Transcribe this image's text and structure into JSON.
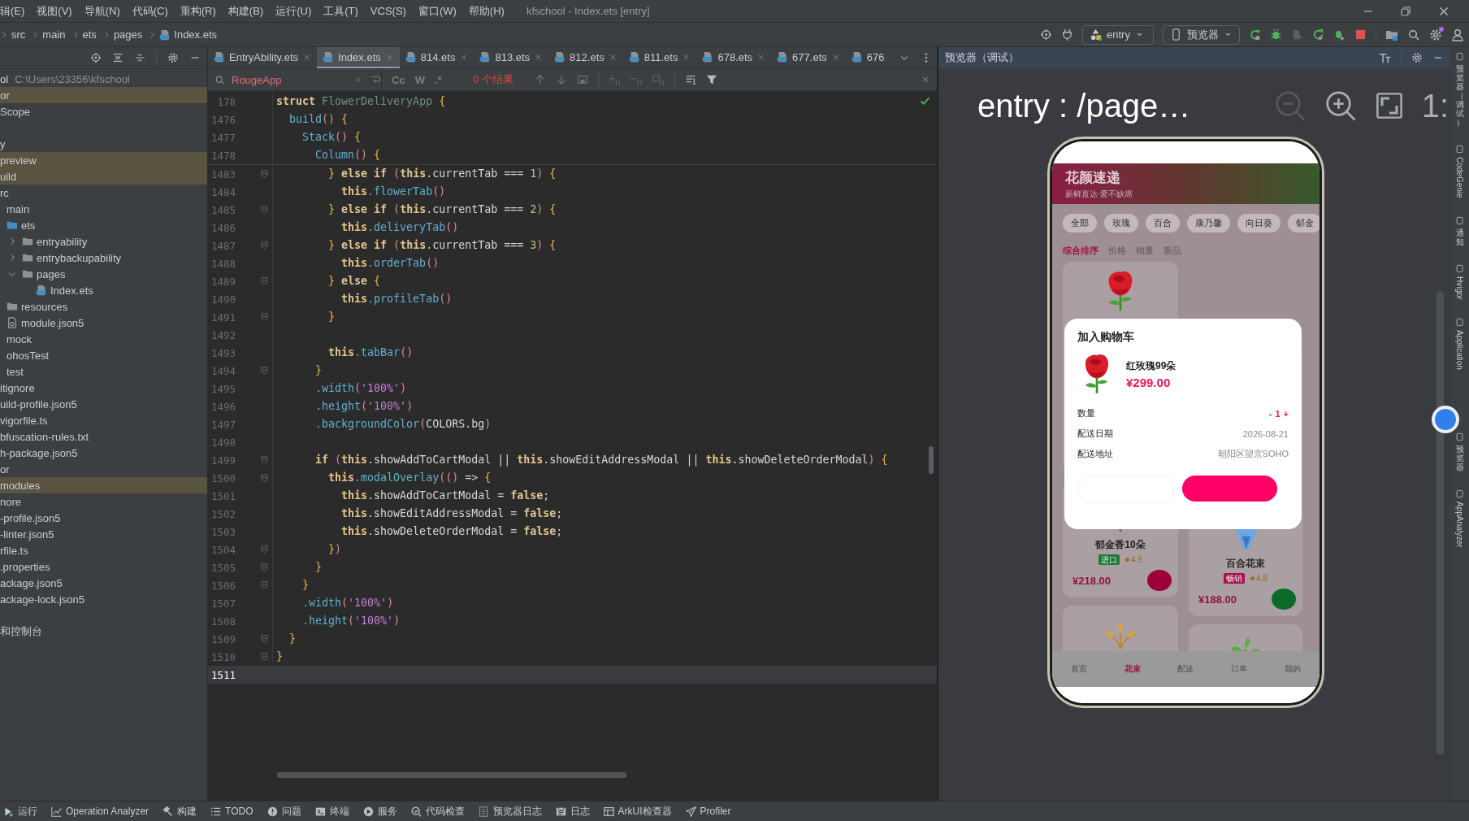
{
  "menu": [
    "辑(E)",
    "视图(V)",
    "导航(N)",
    "代码(C)",
    "重构(R)",
    "构建(B)",
    "运行(U)",
    "工具(T)",
    "VCS(S)",
    "窗口(W)",
    "帮助(H)"
  ],
  "window": {
    "title": "kfschool - Index.ets [entry]"
  },
  "breadcrumb": [
    {
      "label": "src",
      "kind": "folder"
    },
    {
      "label": "main",
      "kind": "folder"
    },
    {
      "label": "ets",
      "kind": "folder"
    },
    {
      "label": "pages",
      "kind": "folder"
    },
    {
      "label": "Index.ets",
      "kind": "file"
    }
  ],
  "toolbar": {
    "run_config": "entry",
    "device": "预览器"
  },
  "project": {
    "root": {
      "name": "ol",
      "path": "C:\\Users\\23356\\kfschool"
    },
    "items": [
      {
        "label": "or",
        "highlighted": true
      },
      {
        "label": "Scope",
        "highlighted": false
      },
      {
        "label": "y",
        "highlighted": false
      },
      {
        "label": "preview",
        "highlighted": true
      },
      {
        "label": "uild",
        "highlighted": true
      },
      {
        "label": "rc",
        "highlighted": false,
        "children": [
          {
            "label": "main",
            "highlighted": false,
            "children": [
              {
                "label": "ets",
                "highlighted": false,
                "kind": "source_folder",
                "children": [
                  {
                    "label": "entryability",
                    "highlighted": false,
                    "kind": "folder",
                    "expanded": false
                  },
                  {
                    "label": "entrybackupability",
                    "highlighted": false,
                    "kind": "folder",
                    "expanded": false
                  },
                  {
                    "label": "pages",
                    "highlighted": false,
                    "kind": "folder",
                    "expanded": true,
                    "children": [
                      {
                        "label": "Index.ets",
                        "highlighted": false,
                        "kind": "ets_file"
                      }
                    ]
                  }
                ]
              },
              {
                "label": "resources",
                "highlighted": false,
                "kind": "folder"
              },
              {
                "label": "module.json5",
                "highlighted": false,
                "kind": "config_file"
              }
            ]
          },
          {
            "label": "mock",
            "highlighted": false
          },
          {
            "label": "ohosTest",
            "highlighted": false
          },
          {
            "label": "test",
            "highlighted": false
          }
        ]
      },
      {
        "label": "itignore",
        "highlighted": false
      },
      {
        "label": "uild-profile.json5",
        "highlighted": false
      },
      {
        "label": "vigorfile.ts",
        "highlighted": false
      },
      {
        "label": "bfuscation-rules.txt",
        "highlighted": false
      },
      {
        "label": "h-package.json5",
        "highlighted": false
      },
      {
        "label": "or",
        "highlighted": false
      },
      {
        "label": "modules",
        "highlighted": true
      },
      {
        "label": "nore",
        "highlighted": false
      },
      {
        "label": "-profile.json5",
        "highlighted": false
      },
      {
        "label": "-linter.json5",
        "highlighted": false
      },
      {
        "label": "rfile.ts",
        "highlighted": false
      },
      {
        "label": ".properties",
        "highlighted": false
      },
      {
        "label": "ackage.json5",
        "highlighted": false
      },
      {
        "label": "ackage-lock.json5",
        "highlighted": false
      },
      {
        "label": "和控制台",
        "highlighted": false
      }
    ]
  },
  "editor": {
    "tabs": [
      {
        "label": "EntryAbility.ets",
        "selected": false,
        "closable": true
      },
      {
        "label": "Index.ets",
        "selected": true,
        "closable": true
      },
      {
        "label": "814.ets",
        "selected": false,
        "closable": true
      },
      {
        "label": "813.ets",
        "selected": false,
        "closable": true
      },
      {
        "label": "812.ets",
        "selected": false,
        "closable": true
      },
      {
        "label": "811.ets",
        "selected": false,
        "closable": true
      },
      {
        "label": "678.ets",
        "selected": false,
        "closable": true
      },
      {
        "label": "677.ets",
        "selected": false,
        "closable": true
      },
      {
        "label": "676",
        "selected": false,
        "closable": false
      }
    ],
    "search": {
      "query": "RougeApp",
      "options": [
        "Cc",
        "W",
        ".*"
      ],
      "result": "0 个结果"
    },
    "sticky_lines": [
      {
        "number": "178",
        "tokens": [
          {
            "kind": "keyword",
            "text": "struct "
          },
          {
            "kind": "type",
            "text": "FlowerDeliveryApp "
          },
          {
            "kind": "brace",
            "text": "{"
          }
        ]
      },
      {
        "number": "1476",
        "tokens": [
          {
            "kind": "function",
            "text": "  build"
          },
          {
            "kind": "paren",
            "text": "() "
          },
          {
            "kind": "brace",
            "text": "{"
          }
        ]
      },
      {
        "number": "1477",
        "tokens": [
          {
            "kind": "function",
            "text": "    Stack"
          },
          {
            "kind": "paren",
            "text": "() "
          },
          {
            "kind": "brace",
            "text": "{"
          }
        ]
      },
      {
        "number": "1478",
        "tokens": [
          {
            "kind": "function",
            "text": "      Column"
          },
          {
            "kind": "paren",
            "text": "() "
          },
          {
            "kind": "brace",
            "text": "{"
          }
        ]
      }
    ],
    "lines": [
      {
        "number": "1483",
        "fold": true,
        "current": false,
        "tokens": [
          {
            "kind": "brace",
            "text": "        } "
          },
          {
            "kind": "keyword",
            "text": "else if "
          },
          {
            "kind": "paren",
            "text": "("
          },
          {
            "kind": "keyword",
            "text": "this"
          },
          {
            "kind": "plain",
            "text": ".currentTab === "
          },
          {
            "kind": "number",
            "text": "1"
          },
          {
            "kind": "paren",
            "text": ") "
          },
          {
            "kind": "brace",
            "text": "{"
          }
        ]
      },
      {
        "number": "1484",
        "fold": false,
        "current": false,
        "tokens": [
          {
            "kind": "keyword",
            "text": "          this"
          },
          {
            "kind": "function",
            "text": ".flowerTab"
          },
          {
            "kind": "paren",
            "text": "()"
          }
        ]
      },
      {
        "number": "1485",
        "fold": true,
        "current": false,
        "tokens": [
          {
            "kind": "brace",
            "text": "        } "
          },
          {
            "kind": "keyword",
            "text": "else if "
          },
          {
            "kind": "paren",
            "text": "("
          },
          {
            "kind": "keyword",
            "text": "this"
          },
          {
            "kind": "plain",
            "text": ".currentTab === "
          },
          {
            "kind": "number",
            "text": "2"
          },
          {
            "kind": "paren",
            "text": ") "
          },
          {
            "kind": "brace",
            "text": "{"
          }
        ]
      },
      {
        "number": "1486",
        "fold": false,
        "current": false,
        "tokens": [
          {
            "kind": "keyword",
            "text": "          this"
          },
          {
            "kind": "function",
            "text": ".deliveryTab"
          },
          {
            "kind": "paren",
            "text": "()"
          }
        ]
      },
      {
        "number": "1487",
        "fold": true,
        "current": false,
        "tokens": [
          {
            "kind": "brace",
            "text": "        } "
          },
          {
            "kind": "keyword",
            "text": "else if "
          },
          {
            "kind": "paren",
            "text": "("
          },
          {
            "kind": "keyword",
            "text": "this"
          },
          {
            "kind": "plain",
            "text": ".currentTab === "
          },
          {
            "kind": "number",
            "text": "3"
          },
          {
            "kind": "paren",
            "text": ") "
          },
          {
            "kind": "brace",
            "text": "{"
          }
        ]
      },
      {
        "number": "1488",
        "fold": false,
        "current": false,
        "tokens": [
          {
            "kind": "keyword",
            "text": "          this"
          },
          {
            "kind": "function",
            "text": ".orderTab"
          },
          {
            "kind": "paren",
            "text": "()"
          }
        ]
      },
      {
        "number": "1489",
        "fold": true,
        "current": false,
        "tokens": [
          {
            "kind": "brace",
            "text": "        } "
          },
          {
            "kind": "keyword",
            "text": "else "
          },
          {
            "kind": "brace",
            "text": "{"
          }
        ]
      },
      {
        "number": "1490",
        "fold": false,
        "current": false,
        "tokens": [
          {
            "kind": "keyword",
            "text": "          this"
          },
          {
            "kind": "function",
            "text": ".profileTab"
          },
          {
            "kind": "paren",
            "text": "()"
          }
        ]
      },
      {
        "number": "1491",
        "fold": true,
        "current": false,
        "tokens": [
          {
            "kind": "brace",
            "text": "        }"
          }
        ]
      },
      {
        "number": "1492",
        "fold": false,
        "current": false
      },
      {
        "number": "1493",
        "fold": false,
        "current": false,
        "tokens": [
          {
            "kind": "keyword",
            "text": "        this"
          },
          {
            "kind": "function",
            "text": ".tabBar"
          },
          {
            "kind": "paren",
            "text": "()"
          }
        ]
      },
      {
        "number": "1494",
        "fold": true,
        "current": false,
        "tokens": [
          {
            "kind": "brace",
            "text": "      }"
          }
        ]
      },
      {
        "number": "1495",
        "fold": false,
        "current": false,
        "tokens": [
          {
            "kind": "function",
            "text": "      .width"
          },
          {
            "kind": "paren",
            "text": "("
          },
          {
            "kind": "string",
            "text": "'100%'"
          },
          {
            "kind": "paren",
            "text": ")"
          }
        ]
      },
      {
        "number": "1496",
        "fold": false,
        "current": false,
        "tokens": [
          {
            "kind": "function",
            "text": "      .height"
          },
          {
            "kind": "paren",
            "text": "("
          },
          {
            "kind": "string",
            "text": "'100%'"
          },
          {
            "kind": "paren",
            "text": ")"
          }
        ]
      },
      {
        "number": "1497",
        "fold": false,
        "current": false,
        "tokens": [
          {
            "kind": "function",
            "text": "      .backgroundColor"
          },
          {
            "kind": "paren",
            "text": "("
          },
          {
            "kind": "plain",
            "text": "COLORS.bg"
          },
          {
            "kind": "paren",
            "text": ")"
          }
        ]
      },
      {
        "number": "1498",
        "fold": false,
        "current": false
      },
      {
        "number": "1499",
        "fold": true,
        "current": false,
        "tokens": [
          {
            "kind": "keyword",
            "text": "      if "
          },
          {
            "kind": "paren",
            "text": "("
          },
          {
            "kind": "keyword",
            "text": "this"
          },
          {
            "kind": "plain",
            "text": ".showAddToCartModal || "
          },
          {
            "kind": "keyword",
            "text": "this"
          },
          {
            "kind": "plain",
            "text": ".showEditAddressModal || "
          },
          {
            "kind": "keyword",
            "text": "this"
          },
          {
            "kind": "plain",
            "text": ".showDeleteOrderModal"
          },
          {
            "kind": "paren",
            "text": ") "
          },
          {
            "kind": "brace",
            "text": "{"
          }
        ]
      },
      {
        "number": "1500",
        "fold": true,
        "current": false,
        "tokens": [
          {
            "kind": "keyword",
            "text": "        this"
          },
          {
            "kind": "function",
            "text": ".modalOverlay"
          },
          {
            "kind": "paren",
            "text": "(()"
          },
          {
            "kind": "plain",
            "text": " => "
          },
          {
            "kind": "brace",
            "text": "{"
          }
        ]
      },
      {
        "number": "1501",
        "fold": false,
        "current": false,
        "tokens": [
          {
            "kind": "keyword",
            "text": "          this"
          },
          {
            "kind": "plain",
            "text": ".showAddToCartModal = "
          },
          {
            "kind": "keyword",
            "text": "false"
          },
          {
            "kind": "plain",
            "text": ";"
          }
        ]
      },
      {
        "number": "1502",
        "fold": false,
        "current": false,
        "tokens": [
          {
            "kind": "keyword",
            "text": "          this"
          },
          {
            "kind": "plain",
            "text": ".showEditAddressModal = "
          },
          {
            "kind": "keyword",
            "text": "false"
          },
          {
            "kind": "plain",
            "text": ";"
          }
        ]
      },
      {
        "number": "1503",
        "fold": false,
        "current": false,
        "tokens": [
          {
            "kind": "keyword",
            "text": "          this"
          },
          {
            "kind": "plain",
            "text": ".showDeleteOrderModal = "
          },
          {
            "kind": "keyword",
            "text": "false"
          },
          {
            "kind": "plain",
            "text": ";"
          }
        ]
      },
      {
        "number": "1504",
        "fold": true,
        "current": false,
        "tokens": [
          {
            "kind": "brace",
            "text": "        }"
          },
          {
            "kind": "paren",
            "text": ")"
          }
        ]
      },
      {
        "number": "1505",
        "fold": true,
        "current": false,
        "tokens": [
          {
            "kind": "brace",
            "text": "      }"
          }
        ]
      },
      {
        "number": "1506",
        "fold": true,
        "current": false,
        "tokens": [
          {
            "kind": "brace",
            "text": "    }"
          }
        ]
      },
      {
        "number": "1507",
        "fold": false,
        "current": false,
        "tokens": [
          {
            "kind": "function",
            "text": "    .width"
          },
          {
            "kind": "paren",
            "text": "("
          },
          {
            "kind": "string",
            "text": "'100%'"
          },
          {
            "kind": "paren",
            "text": ")"
          }
        ]
      },
      {
        "number": "1508",
        "fold": false,
        "current": false,
        "tokens": [
          {
            "kind": "function",
            "text": "    .height"
          },
          {
            "kind": "paren",
            "text": "("
          },
          {
            "kind": "string",
            "text": "'100%'"
          },
          {
            "kind": "paren",
            "text": ")"
          }
        ]
      },
      {
        "number": "1509",
        "fold": true,
        "current": false,
        "tokens": [
          {
            "kind": "brace",
            "text": "  }"
          }
        ]
      },
      {
        "number": "1510",
        "fold": true,
        "current": false,
        "tokens": [
          {
            "kind": "brace",
            "text": "}"
          }
        ]
      },
      {
        "number": "1511",
        "fold": false,
        "current": true
      }
    ]
  },
  "preview": {
    "title": "预览器（调试）",
    "path": "entry : /page…",
    "scale": "1:",
    "app": {
      "header": {
        "title": "花颜速递",
        "subtitle": "新鲜直达·爱不缺席"
      },
      "categories": [
        "全部",
        "玫瑰",
        "百合",
        "康乃馨",
        "向日葵",
        "郁金"
      ],
      "sort": [
        {
          "label": "综合排序",
          "selected": true
        },
        {
          "label": "价格",
          "selected": false
        },
        {
          "label": "销量",
          "selected": false
        },
        {
          "label": "新品",
          "selected": false
        }
      ],
      "columns": [
        [
          {
            "kind": "rose"
          },
          {
            "kind": "tulip",
            "name": "郁金香10朵",
            "tag": {
              "label": "进口",
              "color": "#1d7a3a"
            },
            "rating": "★4.9",
            "price": "¥218.00",
            "button": {
              "color": "#9b0038"
            }
          },
          {
            "kind": "wheat"
          }
        ],
        [
          {
            "kind": "bouquet",
            "name": "百合花束",
            "tag": {
              "label": "畅销",
              "color": "#a8124e"
            },
            "rating": "★4.8",
            "price": "¥188.00",
            "button": {
              "color": "#0a6a26"
            }
          },
          {
            "kind": "sprout"
          }
        ]
      ],
      "tabs": [
        {
          "label": "首页",
          "selected": false
        },
        {
          "label": "花束",
          "selected": true
        },
        {
          "label": "配送",
          "selected": false
        },
        {
          "label": "订单",
          "selected": false
        },
        {
          "label": "我的",
          "selected": false
        }
      ],
      "modal": {
        "title": "加入购物车",
        "product": {
          "kind": "rose",
          "name": "红玫瑰99朵",
          "price": "¥299.00"
        },
        "quantity": {
          "label": "数量",
          "minus": "-",
          "count": "1",
          "plus": "+"
        },
        "rows": [
          {
            "label": "配送日期",
            "value": "2026-08-21"
          },
          {
            "label": "配送地址",
            "value": "朝阳区望京SOHO"
          }
        ],
        "buttons": [
          {
            "kind": "secondary"
          },
          {
            "kind": "primary"
          }
        ]
      }
    }
  },
  "side_tools": [
    {
      "label": "预览器（调试）",
      "kind": "cjk"
    },
    {
      "label": "CodeGenie",
      "kind": "latin"
    },
    {
      "label": "通知",
      "kind": "cjk"
    },
    {
      "label": "Hvigor",
      "kind": "latin"
    },
    {
      "label": "Application",
      "kind": "latin"
    },
    {
      "label": "预览器",
      "kind": "cjk"
    },
    {
      "label": "AppAnalyzer",
      "kind": "latin"
    }
  ],
  "bottom_tools": [
    {
      "label": "运行",
      "kind": "run"
    },
    {
      "label": "Operation Analyzer",
      "kind": "chart"
    },
    {
      "label": "构建",
      "kind": "hammer"
    },
    {
      "label": "TODO",
      "kind": "list"
    },
    {
      "label": "问题",
      "kind": "alert"
    },
    {
      "label": "终端",
      "kind": "terminal"
    },
    {
      "label": "服务",
      "kind": "play"
    },
    {
      "label": "代码检查",
      "kind": "inspect"
    },
    {
      "label": "预览器日志",
      "kind": "doc"
    },
    {
      "label": "日志",
      "kind": "log"
    },
    {
      "label": "ArkUI检查器",
      "kind": "table"
    },
    {
      "label": "Profiler",
      "kind": "send"
    }
  ]
}
